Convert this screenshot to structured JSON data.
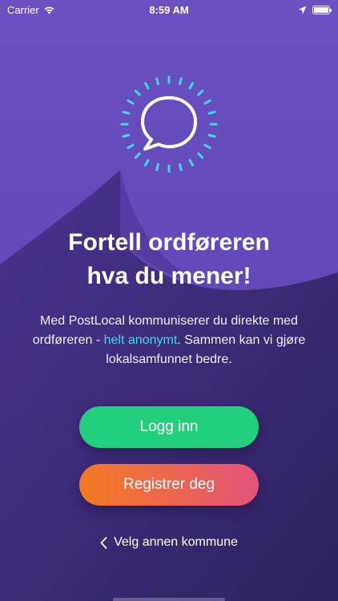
{
  "status_bar": {
    "carrier": "Carrier",
    "time": "8:59 AM"
  },
  "hero": {
    "icon": "speech-bubble-icon",
    "title_line1": "Fortell ordføreren",
    "title_line2": "hva du mener!"
  },
  "description": {
    "part1": "Med PostLocal kommuniserer du direkte med ordføreren - ",
    "highlight": "helt anonymt",
    "part2": ". Sammen kan vi gjøre lokalsamfunnet bedre."
  },
  "buttons": {
    "login_label": "Logg inn",
    "register_label": "Registrer deg"
  },
  "footer": {
    "back_label": "Velg annen kommune"
  },
  "colors": {
    "background_top": "#6a4ec0",
    "background_dark": "#3d2a78",
    "accent_cyan": "#38dbe6",
    "login_green": "#22cf7c",
    "register_orange": "#f37b22",
    "register_pink": "#e2537a"
  }
}
